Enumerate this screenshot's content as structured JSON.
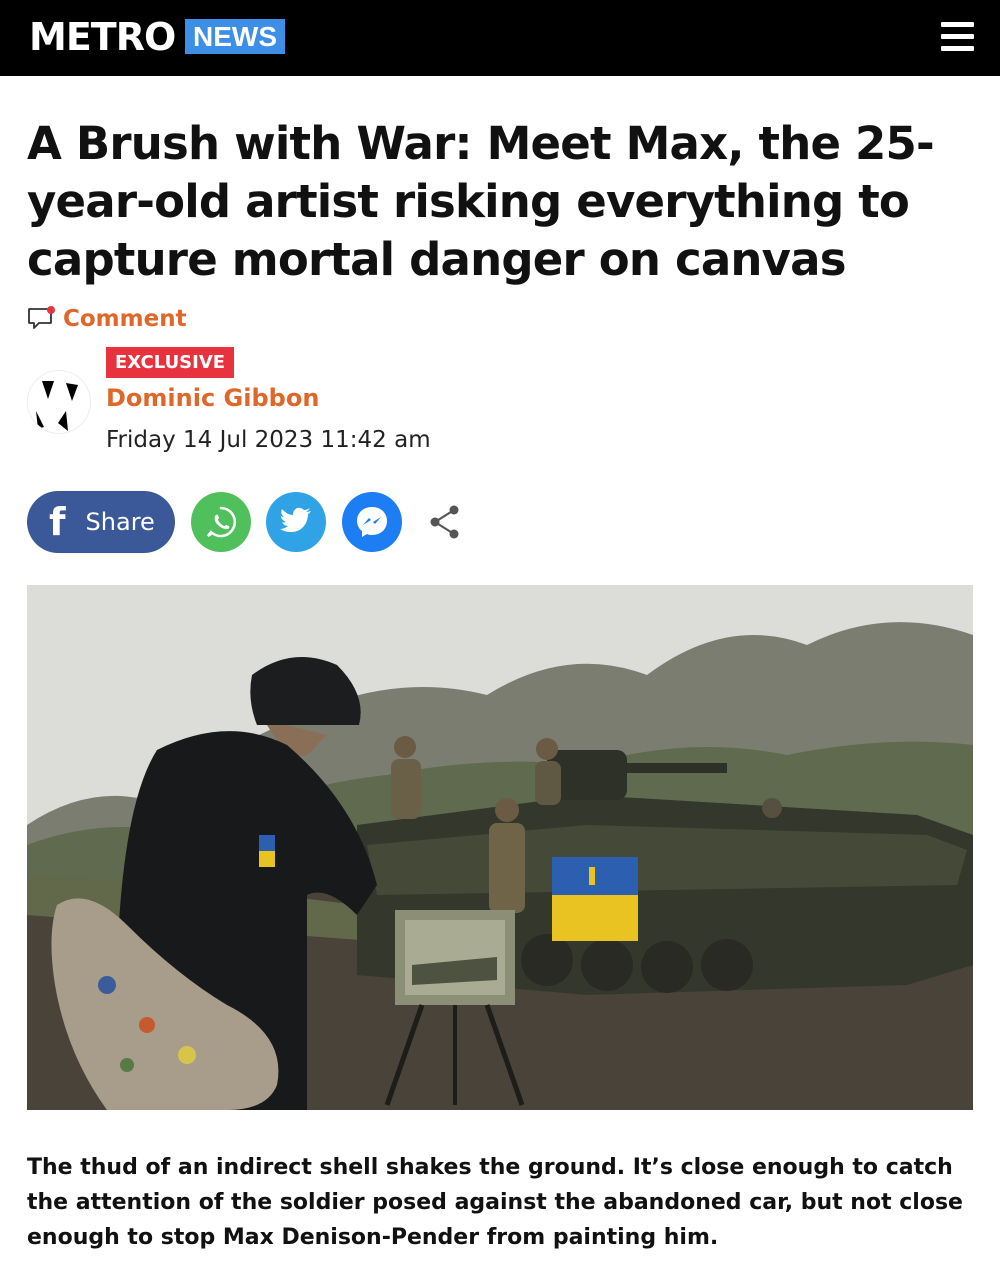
{
  "header": {
    "logo": "METRO",
    "section": "NEWS",
    "menu_icon": "hamburger-menu-icon"
  },
  "article": {
    "headline": "A Brush with War: Meet Max, the 25-year-old artist risking everything to capture mortal danger on canvas",
    "comment_label": "Comment",
    "badge": "EXCLUSIVE",
    "author": "Dominic Gibbon",
    "date": "Friday 14 Jul 2023 11:42 am",
    "lead": "The thud of an indirect shell shakes the ground. It’s close enough to catch the attention of the soldier posed against the abandoned car, but not close enough to stop Max Denison-Pender from painting him."
  },
  "share": {
    "facebook_label": "Share",
    "icons": [
      "facebook-icon",
      "whatsapp-icon",
      "twitter-icon",
      "messenger-icon",
      "share-icon"
    ]
  },
  "colors": {
    "topbar": "#000000",
    "news_badge": "#3d8ee6",
    "accent_orange": "#e0672a",
    "exclusive_red": "#e8333f",
    "facebook": "#3b5998",
    "whatsapp": "#4fc05b",
    "twitter": "#2fa3e6",
    "messenger": "#1c7ef2"
  }
}
